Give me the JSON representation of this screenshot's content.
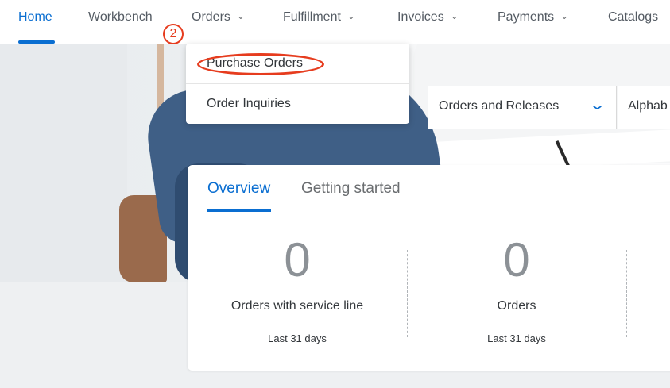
{
  "nav": {
    "items": [
      {
        "label": "Home",
        "active": true
      },
      {
        "label": "Workbench"
      },
      {
        "label": "Orders",
        "dropdown": true
      },
      {
        "label": "Fulfillment",
        "dropdown": true
      },
      {
        "label": "Invoices",
        "dropdown": true
      },
      {
        "label": "Payments",
        "dropdown": true
      },
      {
        "label": "Catalogs"
      }
    ],
    "chevron_icon": "chevron-down-icon"
  },
  "orders_menu": {
    "items": [
      "Purchase Orders",
      "Order Inquiries"
    ]
  },
  "annotation": {
    "step": "2",
    "color": "#e63c1e"
  },
  "filters": {
    "document_type": "Orders and Releases",
    "sort": "Alphab"
  },
  "overview": {
    "tabs": [
      "Overview",
      "Getting started"
    ],
    "active_tab": "Overview",
    "kpis": [
      {
        "value": "0",
        "label": "Orders with service line",
        "period": "Last 31 days"
      },
      {
        "value": "0",
        "label": "Orders",
        "period": "Last 31 days"
      }
    ]
  },
  "colors": {
    "accent": "#0a6ed1",
    "background": "#eef0f2",
    "text": "#32363a"
  }
}
